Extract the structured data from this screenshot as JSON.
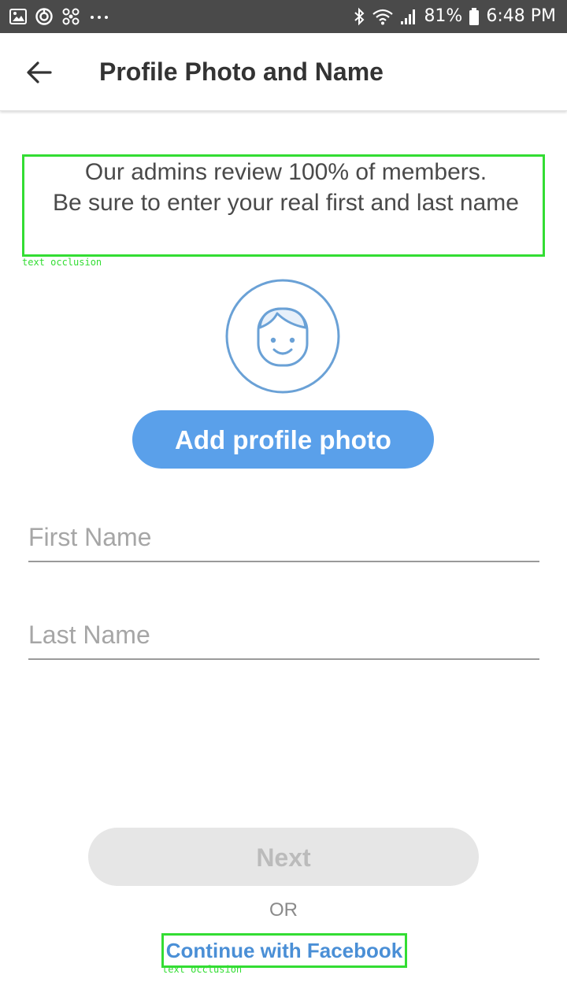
{
  "status_bar": {
    "battery": "81%",
    "time": "6:48 PM",
    "left_icons": [
      "gallery-icon",
      "sync-icon",
      "fan-icon",
      "more-dots-icon"
    ],
    "right_icons": [
      "bluetooth-icon",
      "wifi-icon",
      "signal-icon",
      "battery-icon"
    ]
  },
  "header": {
    "back_icon": "arrow-left-icon",
    "title": "Profile Photo and Name"
  },
  "notice": {
    "line1": "Our admins review 100% of members.",
    "line2": "Be sure to enter your real first and last name",
    "occlusion_label": "text occlusion"
  },
  "avatar": {
    "icon": "face-avatar-icon"
  },
  "actions": {
    "add_photo_label": "Add profile photo",
    "next_label": "Next",
    "or_label": "OR",
    "facebook_label": "Continue with Facebook",
    "facebook_occlusion_label": "text occlusion"
  },
  "form": {
    "first_name": {
      "value": "",
      "placeholder": "First Name"
    },
    "last_name": {
      "value": "",
      "placeholder": "Last Name"
    }
  },
  "colors": {
    "status_bar": "#4a4a4a",
    "accent": "#5aa0ea",
    "disabled": "#e6e6e6",
    "link": "#4a8fd6",
    "annotation": "#33dd33"
  }
}
